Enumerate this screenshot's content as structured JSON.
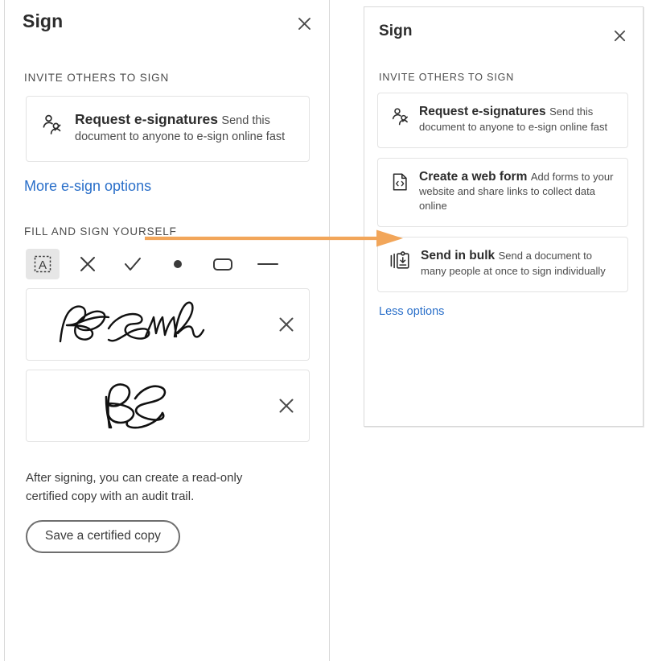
{
  "left_panel": {
    "title": "Sign",
    "close_icon": "close-icon",
    "section_invite_label": "INVITE OTHERS TO SIGN",
    "options": [
      {
        "icon": "request-esignatures-icon",
        "title": "Request e-signatures",
        "desc": "Send this document to anyone to e-sign online fast"
      }
    ],
    "more_options_link": "More e-sign options",
    "section_fill_label": "FILL AND SIGN YOURSELF",
    "tools": [
      {
        "name": "add-text-icon",
        "label": "Add text",
        "selected": true
      },
      {
        "name": "add-cross-icon",
        "label": "Add cross mark",
        "selected": false
      },
      {
        "name": "add-checkmark-icon",
        "label": "Add check mark",
        "selected": false
      },
      {
        "name": "add-dot-icon",
        "label": "Add dot",
        "selected": false
      },
      {
        "name": "add-rectangle-icon",
        "label": "Add rectangle",
        "selected": false
      },
      {
        "name": "add-line-icon",
        "label": "Add line",
        "selected": false
      }
    ],
    "signatures": [
      {
        "name": "saved-signature",
        "label": "Bob Smith",
        "delete_icon": "close-icon"
      },
      {
        "name": "saved-initials",
        "label": "BS",
        "delete_icon": "close-icon"
      }
    ],
    "footer_note": "After signing, you can create a read-only certified copy with an audit trail.",
    "certified_copy_button": "Save a certified copy"
  },
  "right_panel": {
    "title": "Sign",
    "close_icon": "close-icon",
    "section_invite_label": "INVITE OTHERS TO SIGN",
    "options": [
      {
        "icon": "request-esignatures-icon",
        "title": "Request e-signatures",
        "desc": "Send this document to anyone to e-sign online fast"
      },
      {
        "icon": "web-form-icon",
        "title": "Create a web form",
        "desc": "Add forms to your website and share links to collect data online"
      },
      {
        "icon": "send-in-bulk-icon",
        "title": "Send in bulk",
        "desc": "Send a document to many people at once to sign individually"
      }
    ],
    "less_options_link": "Less options"
  },
  "annotation": {
    "arrow_name": "annotation-arrow",
    "color": "#f2a65a"
  },
  "colors": {
    "link": "#2a6fc9",
    "text": "#2c2c2c",
    "muted_text": "#4b4b4b",
    "card_border": "#e3e3e3",
    "panel_border": "#d8d8d8",
    "tool_selected_bg": "#e6e6e6",
    "arrow_orange": "#f2a65a"
  }
}
